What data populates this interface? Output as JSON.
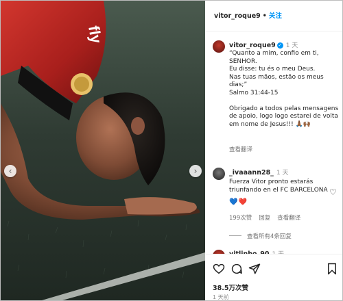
{
  "header": {
    "username": "vitor_roque9",
    "separator": "•",
    "follow_label": "关注"
  },
  "caption": {
    "username": "vitor_roque9",
    "time": "1 天",
    "lines": [
      "“Quanto a mim, confio em ti, SENHOR.",
      "Eu disse: tu és o meu Deus.",
      "Nas tuas mãos, estão os meus dias;”",
      "Salmo 31:44-15",
      "",
      "Obrigado a todos pelas mensagens de apoio, logo logo estarei de volta em nome de Jesus!!! 🙏🏾🙌🏾"
    ],
    "translate_label": "查看翻译"
  },
  "comment": {
    "username": "_ivaaann28_",
    "time": "1 天",
    "text": "Fuerza Vitor pronto estarás triunfando en el FC BARCELONA",
    "emojis": "💙❤️",
    "likes_label": "199次赞",
    "reply_label": "回复",
    "translate_label": "查看翻译",
    "more_replies_label": "查看所有4条回复"
  },
  "next_comment": {
    "username": "vitlinho_90",
    "time": "1 天"
  },
  "footer": {
    "likes": "38.5万次赞",
    "posted": "1 天前"
  },
  "carousel": {
    "prev_arrow": "‹",
    "next_arrow": "›"
  },
  "photo": {
    "jersey_text": "fly"
  },
  "colors": {
    "accent": "#0095f6",
    "jersey_red": "#c62828",
    "turf": "#2c3a30"
  }
}
